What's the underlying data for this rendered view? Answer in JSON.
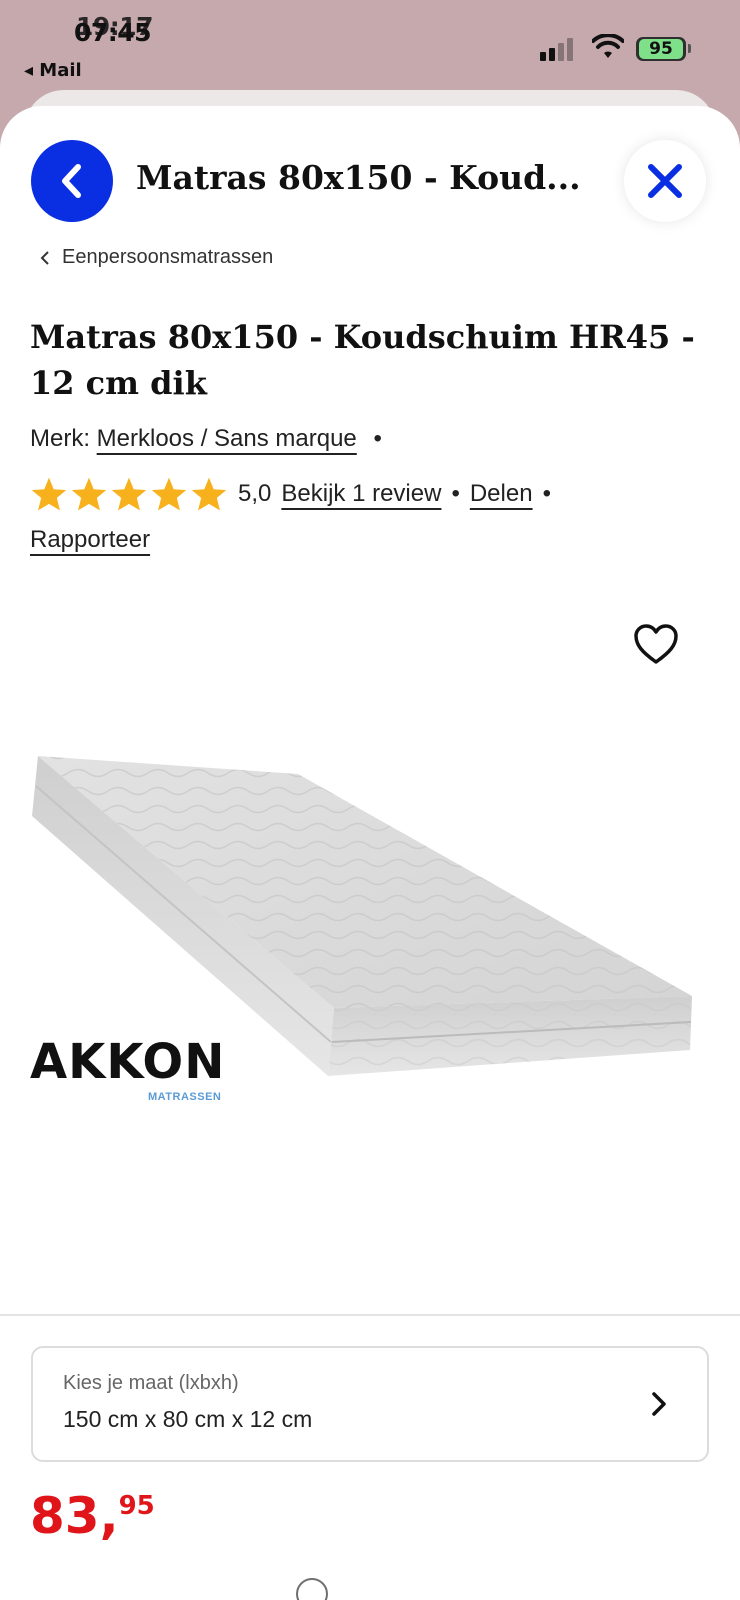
{
  "status_bar": {
    "time": "07:45",
    "time_overlay": "19:17",
    "back_app": "◂ Mail",
    "battery": "95"
  },
  "header": {
    "title": "Matras 80x150 - Koud..."
  },
  "breadcrumb": {
    "label": "Eenpersoonsmatrassen"
  },
  "product": {
    "title": "Matras 80x150 - Koudschuim HR45 - 12 cm dik",
    "brand_prefix": "Merk:",
    "brand": "Merkloos / Sans marque",
    "rating_value": 5.0,
    "rating_text": "5,0",
    "stars": 5,
    "review_link": "Bekijk 1 review",
    "share_link": "Delen",
    "report_link": "Rapporteer",
    "image_brand": "AKKON",
    "image_brand_sub": "MATRASSEN"
  },
  "size_selector": {
    "label": "Kies je maat (lxbxh)",
    "value": "150 cm x 80 cm x 12 cm"
  },
  "price": {
    "main": "83,",
    "cents": "95"
  },
  "colors": {
    "accent_blue": "#0a2fe2",
    "price_red": "#e0151a",
    "star_yellow": "#f7b11c",
    "status_bg": "#c6a9ad"
  },
  "icons": [
    "back-chevron-icon",
    "close-icon",
    "heart-icon",
    "star-icon",
    "chevron-right-icon",
    "wifi-icon",
    "signal-icon",
    "battery-icon"
  ]
}
